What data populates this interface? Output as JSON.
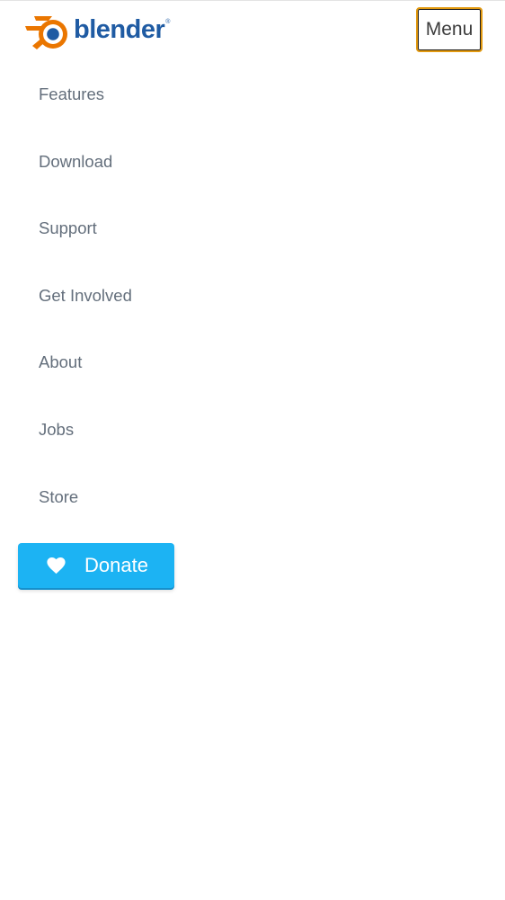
{
  "header": {
    "logo_text": "blender",
    "logo_registered": "®",
    "menu_label": "Menu",
    "brand_colors": {
      "logo_orange": "#ea7600",
      "logo_blue": "#1f5ba3",
      "menu_focus_outline": "#e39a10"
    }
  },
  "nav": {
    "items": [
      {
        "label": "Features"
      },
      {
        "label": "Download"
      },
      {
        "label": "Support"
      },
      {
        "label": "Get Involved"
      },
      {
        "label": "About"
      },
      {
        "label": "Jobs"
      },
      {
        "label": "Store"
      }
    ]
  },
  "donate": {
    "label": "Donate",
    "icon": "heart-icon",
    "color": "#1cb3f3"
  }
}
